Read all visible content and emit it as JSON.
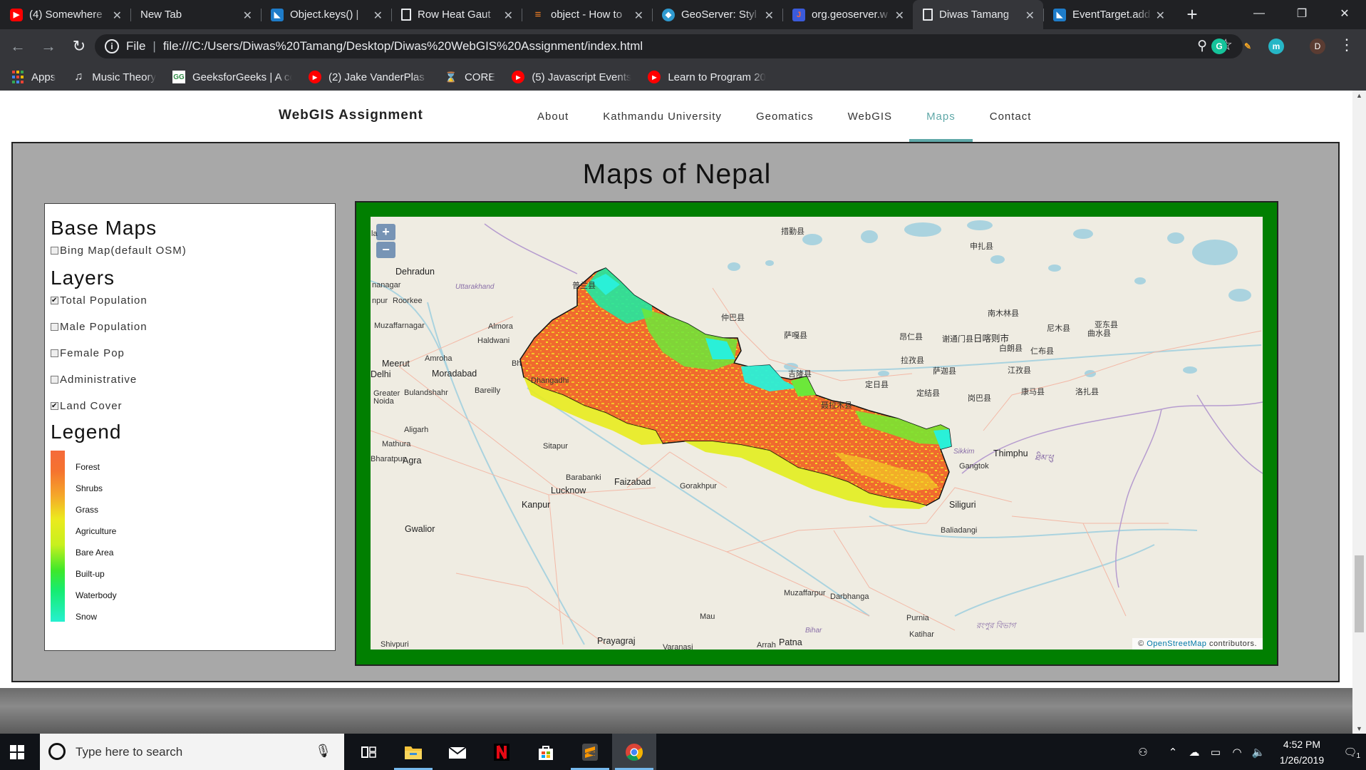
{
  "browser": {
    "tabs": [
      {
        "title": "(4) Somewhere",
        "icon": "youtube-icon",
        "color": "#ff0000"
      },
      {
        "title": "New Tab",
        "icon": "none",
        "color": ""
      },
      {
        "title": "Object.keys() | ",
        "icon": "mdn-icon",
        "color": "#1e7cc9"
      },
      {
        "title": "Row Heat Gaut",
        "icon": "page-icon",
        "color": ""
      },
      {
        "title": "object - How to",
        "icon": "stackoverflow-icon",
        "color": "#f48024"
      },
      {
        "title": "GeoServer: Styl",
        "icon": "geoserver-icon",
        "color": "#2f9ad0"
      },
      {
        "title": "org.geoserver.w",
        "icon": "java-icon",
        "color": "#3b5bdb"
      },
      {
        "title": "Diwas Tamang",
        "icon": "page-icon",
        "color": ""
      },
      {
        "title": "EventTarget.add",
        "icon": "mdn-icon",
        "color": "#1e7cc9"
      }
    ],
    "active_tab_index": 7,
    "url_scheme": "File",
    "url": "file:///C:/Users/Diwas%20Tamang/Desktop/Diwas%20WebGIS%20Assignment/index.html",
    "profile_initial": "D",
    "bookmarks": [
      {
        "label": "Apps",
        "icon": "apps-icon"
      },
      {
        "label": "Music Theory",
        "icon": "music-icon"
      },
      {
        "label": "GeeksforGeeks | A co",
        "icon": "gfg-icon"
      },
      {
        "label": "(2) Jake VanderPlas -",
        "icon": "youtube-icon"
      },
      {
        "label": "CORE",
        "icon": "core-icon"
      },
      {
        "label": "(5) Javascript Events T",
        "icon": "youtube-icon"
      },
      {
        "label": "Learn to Program 20",
        "icon": "youtube-icon"
      }
    ]
  },
  "site": {
    "brand": "WebGIS Assignment",
    "nav": [
      "About",
      "Kathmandu University",
      "Geomatics",
      "WebGIS",
      "Maps",
      "Contact"
    ],
    "active_nav": "Maps",
    "accent": "#5fa8a8"
  },
  "section": {
    "title": "Maps of Nepal"
  },
  "panel": {
    "base_maps_heading": "Base Maps",
    "base_map_option": {
      "label": "Bing Map(default OSM)",
      "checked": false
    },
    "layers_heading": "Layers",
    "layers": [
      {
        "label": "Total Population",
        "checked": true
      },
      {
        "label": "Male Population",
        "checked": false
      },
      {
        "label": "Female Pop",
        "checked": false
      },
      {
        "label": "Administrative",
        "checked": false
      },
      {
        "label": "Land Cover",
        "checked": true
      }
    ],
    "legend_heading": "Legend",
    "legend": [
      {
        "label": "Forest",
        "color": "#f56a3a"
      },
      {
        "label": "Shrubs",
        "color": "#f5932f"
      },
      {
        "label": "Grass",
        "color": "#f2d020"
      },
      {
        "label": "Agriculture",
        "color": "#e6ee1e"
      },
      {
        "label": "Bare Area",
        "color": "#8aec22"
      },
      {
        "label": "Built-up",
        "color": "#22e62e"
      },
      {
        "label": "Waterbody",
        "color": "#1aee8a"
      },
      {
        "label": "Snow",
        "color": "#26f0d6"
      }
    ]
  },
  "map": {
    "zoom_in": "+",
    "zoom_out": "−",
    "attribution_prefix": "©",
    "attribution_link": "OpenStreetMap",
    "attribution_suffix": "contributors.",
    "places": [
      "Dehradun",
      "Uttarakhand",
      "nanagar",
      "Roorkee",
      "npur",
      "Muzaffarnagar",
      "Almora",
      "Haldwani",
      "Meerut",
      "Amroha",
      "Moradabad",
      "Delhi",
      "Greater Noida",
      "Bulandshahr",
      "Bareilly",
      "Aligarh",
      "Mathura",
      "Bharatpur",
      "Agra",
      "Sitapur",
      "Barabanki",
      "Lucknow",
      "Faizabad",
      "Gorakhpur",
      "Kanpur",
      "Gwalior",
      "Shivpuri",
      "Prayagraj",
      "Varanasi",
      "Mau",
      "Arrah",
      "Patna",
      "Muzaffarpur",
      "Darbhanga",
      "Purnia",
      "Katihar",
      "Bihar",
      "Siliguri",
      "Baliadangi",
      "Gangtok",
      "Sikkim",
      "Thimphu",
      "ཐིམ་ཕུ",
      "রংপুর বিভাগ",
      "措勤县",
      "申扎县",
      "仲巴县",
      "萨嘎县",
      "昂仁县",
      "谢通门县",
      "日喀则市",
      "南木林县",
      "尼木县",
      "曲水县",
      "白朗县",
      "仁布县",
      "拉孜县",
      "萨迦县",
      "江孜县",
      "吉隆县",
      "定日县",
      "定结县",
      "岗巴县",
      "康马县",
      "洛扎县",
      "亚东县",
      "聂拉木县",
      "普兰县",
      "Dhangadhi",
      "Bh",
      "la"
    ]
  },
  "taskbar": {
    "search_placeholder": "Type here to search",
    "time": "4:52 PM",
    "date": "1/26/2019",
    "notification_count": "1"
  }
}
